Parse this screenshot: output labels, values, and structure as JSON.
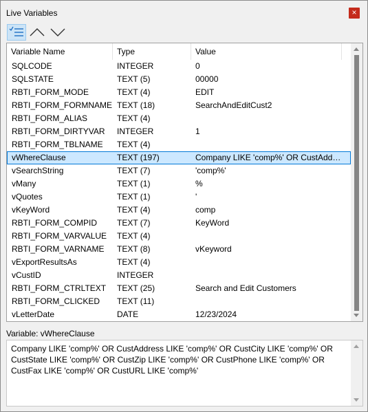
{
  "window": {
    "title": "Live Variables",
    "close_glyph": "×"
  },
  "toolbar": {
    "buttons": [
      {
        "icon": "checklist-icon",
        "active": true
      },
      {
        "icon": "chevron-up-icon",
        "active": false
      },
      {
        "icon": "chevron-down-icon",
        "active": false
      }
    ]
  },
  "grid": {
    "columns": [
      "Variable Name",
      "Type",
      "Value"
    ],
    "rows": [
      {
        "name": "SQLCODE",
        "type": "INTEGER",
        "value": "0"
      },
      {
        "name": "SQLSTATE",
        "type": "TEXT (5)",
        "value": "00000"
      },
      {
        "name": "RBTI_FORM_MODE",
        "type": "TEXT (4)",
        "value": "EDIT"
      },
      {
        "name": "RBTI_FORM_FORMNAME",
        "type": "TEXT (18)",
        "value": "SearchAndEditCust2"
      },
      {
        "name": "RBTI_FORM_ALIAS",
        "type": "TEXT (4)",
        "value": ""
      },
      {
        "name": "RBTI_FORM_DIRTYVAR",
        "type": "INTEGER",
        "value": "1"
      },
      {
        "name": "RBTI_FORM_TBLNAME",
        "type": "TEXT (4)",
        "value": ""
      },
      {
        "name": "vWhereClause",
        "type": "TEXT (197)",
        "value": "Company LIKE 'comp%' OR CustAddress LIKE 'comp%' OR CustCity LIKE 'comp%'",
        "selected": true
      },
      {
        "name": "vSearchString",
        "type": "TEXT (7)",
        "value": "'comp%'"
      },
      {
        "name": "vMany",
        "type": "TEXT (1)",
        "value": "%"
      },
      {
        "name": "vQuotes",
        "type": "TEXT (1)",
        "value": "'"
      },
      {
        "name": "vKeyWord",
        "type": "TEXT (4)",
        "value": "comp"
      },
      {
        "name": "RBTI_FORM_COMPID",
        "type": "TEXT (7)",
        "value": "KeyWord"
      },
      {
        "name": "RBTI_FORM_VARVALUE",
        "type": "TEXT (4)",
        "value": ""
      },
      {
        "name": "RBTI_FORM_VARNAME",
        "type": "TEXT (8)",
        "value": "vKeyword"
      },
      {
        "name": "vExportResultsAs",
        "type": "TEXT (4)",
        "value": ""
      },
      {
        "name": "vCustID",
        "type": "INTEGER",
        "value": ""
      },
      {
        "name": "RBTI_FORM_CTRLTEXT",
        "type": "TEXT (25)",
        "value": "Search and Edit Customers"
      },
      {
        "name": "RBTI_FORM_CLICKED",
        "type": "TEXT (11)",
        "value": ""
      },
      {
        "name": "vLetterDate",
        "type": "DATE",
        "value": "12/23/2024"
      }
    ]
  },
  "detail": {
    "label": "Variable: vWhereClause",
    "text": "Company LIKE 'comp%' OR CustAddress LIKE 'comp%' OR CustCity LIKE 'comp%' OR CustState LIKE 'comp%' OR CustZip LIKE 'comp%' OR CustPhone LIKE 'comp%' OR CustFax LIKE 'comp%' OR CustURL LIKE 'comp%'"
  },
  "colors": {
    "selection": "#cce8ff",
    "selection_border": "#0078d7",
    "close": "#c42b1c"
  }
}
